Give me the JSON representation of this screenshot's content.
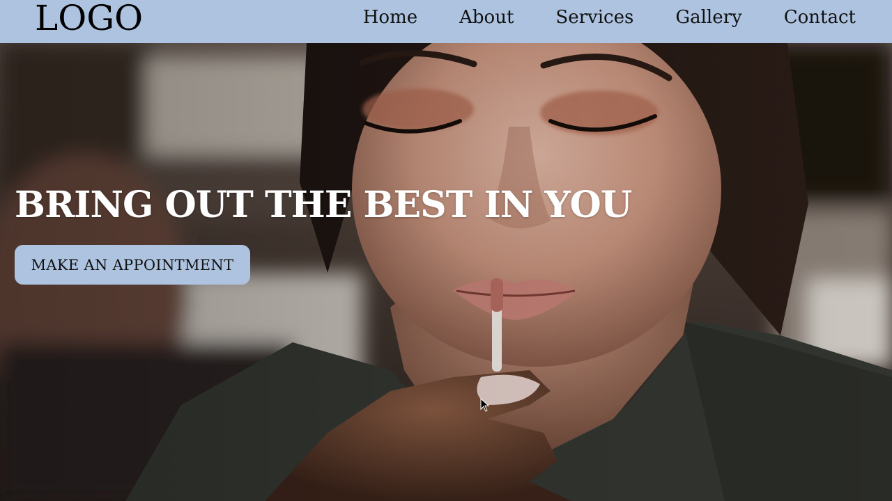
{
  "header": {
    "logo": "LOGO",
    "nav": [
      "Home",
      "About",
      "Services",
      "Gallery",
      "Contact"
    ]
  },
  "hero": {
    "headline": "BRING OUT THE BEST IN YOU",
    "cta_label": "MAKE AN APPOINTMENT",
    "image": "makeup-lip-gloss-portrait"
  },
  "colors": {
    "accent": "#adc3df",
    "headline": "#ffffff",
    "text_dark": "#111111"
  }
}
